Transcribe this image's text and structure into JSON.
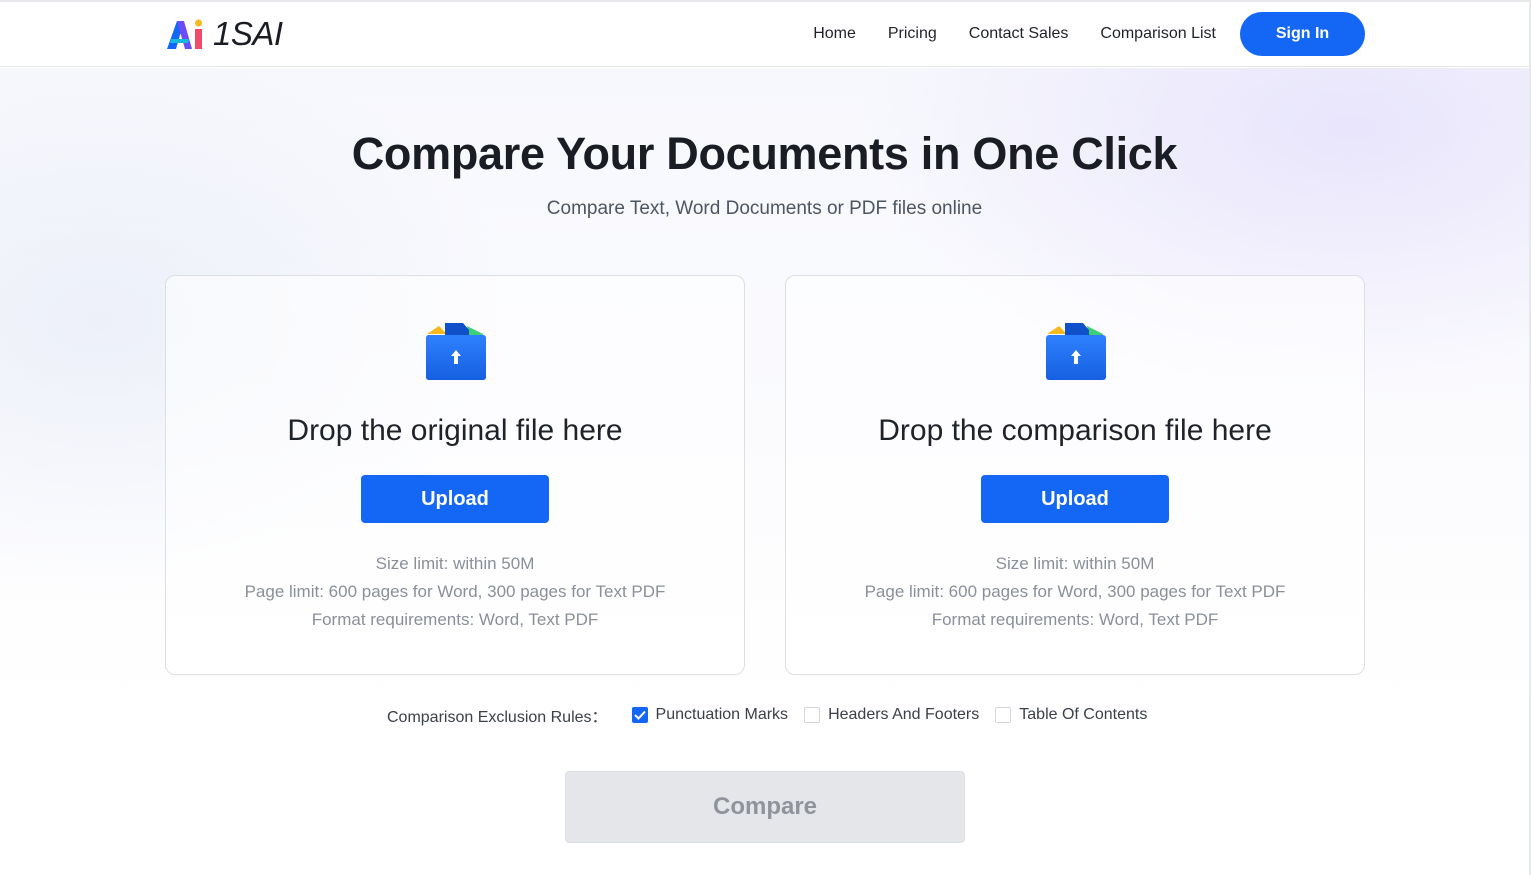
{
  "brand": {
    "logo_text": "1SAI"
  },
  "nav": {
    "items": [
      {
        "label": "Home"
      },
      {
        "label": "Pricing"
      },
      {
        "label": "Contact Sales"
      },
      {
        "label": "Comparison List"
      }
    ],
    "sign_in": "Sign In"
  },
  "hero": {
    "title": "Compare Your Documents in One Click",
    "subtitle": "Compare Text, Word Documents or PDF files online"
  },
  "cards": [
    {
      "title": "Drop the original file here",
      "upload": "Upload",
      "size_limit": "Size limit: within 50M",
      "page_limit": "Page limit: 600 pages for Word, 300 pages for Text PDF",
      "format": "Format requirements: Word, Text PDF"
    },
    {
      "title": "Drop the comparison file here",
      "upload": "Upload",
      "size_limit": "Size limit: within 50M",
      "page_limit": "Page limit: 600 pages for Word, 300 pages for Text PDF",
      "format": "Format requirements: Word, Text PDF"
    }
  ],
  "rules": {
    "label": "Comparison Exclusion Rules：",
    "options": [
      {
        "label": "Punctuation Marks",
        "checked": true
      },
      {
        "label": "Headers And Footers",
        "checked": false
      },
      {
        "label": "Table Of Contents",
        "checked": false
      }
    ]
  },
  "compare_button": "Compare",
  "icons": {
    "folder": "upload-folder-icon",
    "check": "check-icon"
  },
  "colors": {
    "primary": "#1467f5",
    "disabled_bg": "#e4e6ea",
    "disabled_text": "#8f949c"
  }
}
